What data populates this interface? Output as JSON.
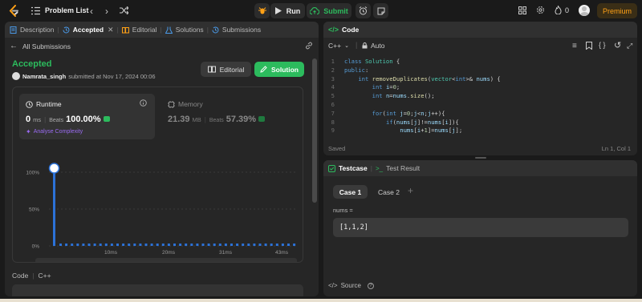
{
  "topbar": {
    "title": "Problem List",
    "run_label": "Run",
    "submit_label": "Submit",
    "fire_count": "0",
    "premium_label": "Premium"
  },
  "left_tabs": {
    "description": "Description",
    "accepted": "Accepted",
    "editorial": "Editorial",
    "solutions": "Solutions",
    "submissions": "Submissions"
  },
  "submission": {
    "back_label": "All Submissions",
    "status": "Accepted",
    "user": "Namrata_singh",
    "submitted_text": "submitted at Nov 17, 2024 00:06",
    "editorial_btn": "Editorial",
    "solution_btn": "Solution",
    "runtime_label": "Runtime",
    "runtime_value": "0",
    "runtime_unit": "ms",
    "beats_label": "Beats",
    "runtime_beats": "100.00%",
    "analyse_label": "Analyse Complexity",
    "memory_label": "Memory",
    "memory_value": "21.39",
    "memory_unit": "MB",
    "memory_beats": "57.39%"
  },
  "chart_data": {
    "type": "bar",
    "y_ticks": [
      "100%",
      "50%",
      "0%"
    ],
    "x_ticks": [
      "10ms",
      "20ms",
      "31ms",
      "43ms"
    ],
    "mini_x_ticks": [
      "10ms",
      "20ms",
      "31ms",
      "43ms"
    ],
    "highlight_value": 100,
    "ylim": [
      0,
      100
    ]
  },
  "left_bottom": {
    "code_label": "Code",
    "lang_label": "C++",
    "code_preview": "class Solution {"
  },
  "code_panel": {
    "title": "Code",
    "lang": "C++",
    "auto": "Auto",
    "saved": "Saved",
    "cursor": "Ln 1, Col 1",
    "lines": [
      "class Solution {",
      "public:",
      "    int removeDuplicates(vector<int>& nums) {",
      "        int i=0;",
      "        int n=nums.size();",
      "",
      "        for(int j=0;j<n;j++){",
      "            if(nums[j]!=nums[i]){",
      "                nums[i+1]=nums[j];"
    ]
  },
  "testcase": {
    "tab_testcase": "Testcase",
    "tab_result": "Test Result",
    "case1": "Case 1",
    "case2": "Case 2",
    "param_name": "nums =",
    "param_value": "[1,1,2]",
    "source_label": "Source"
  },
  "colors": {
    "accent_green": "#2cbb5d",
    "submit_green": "#2cbb5d",
    "premium": "#ffa116",
    "bar_blue": "#2c72d8"
  }
}
